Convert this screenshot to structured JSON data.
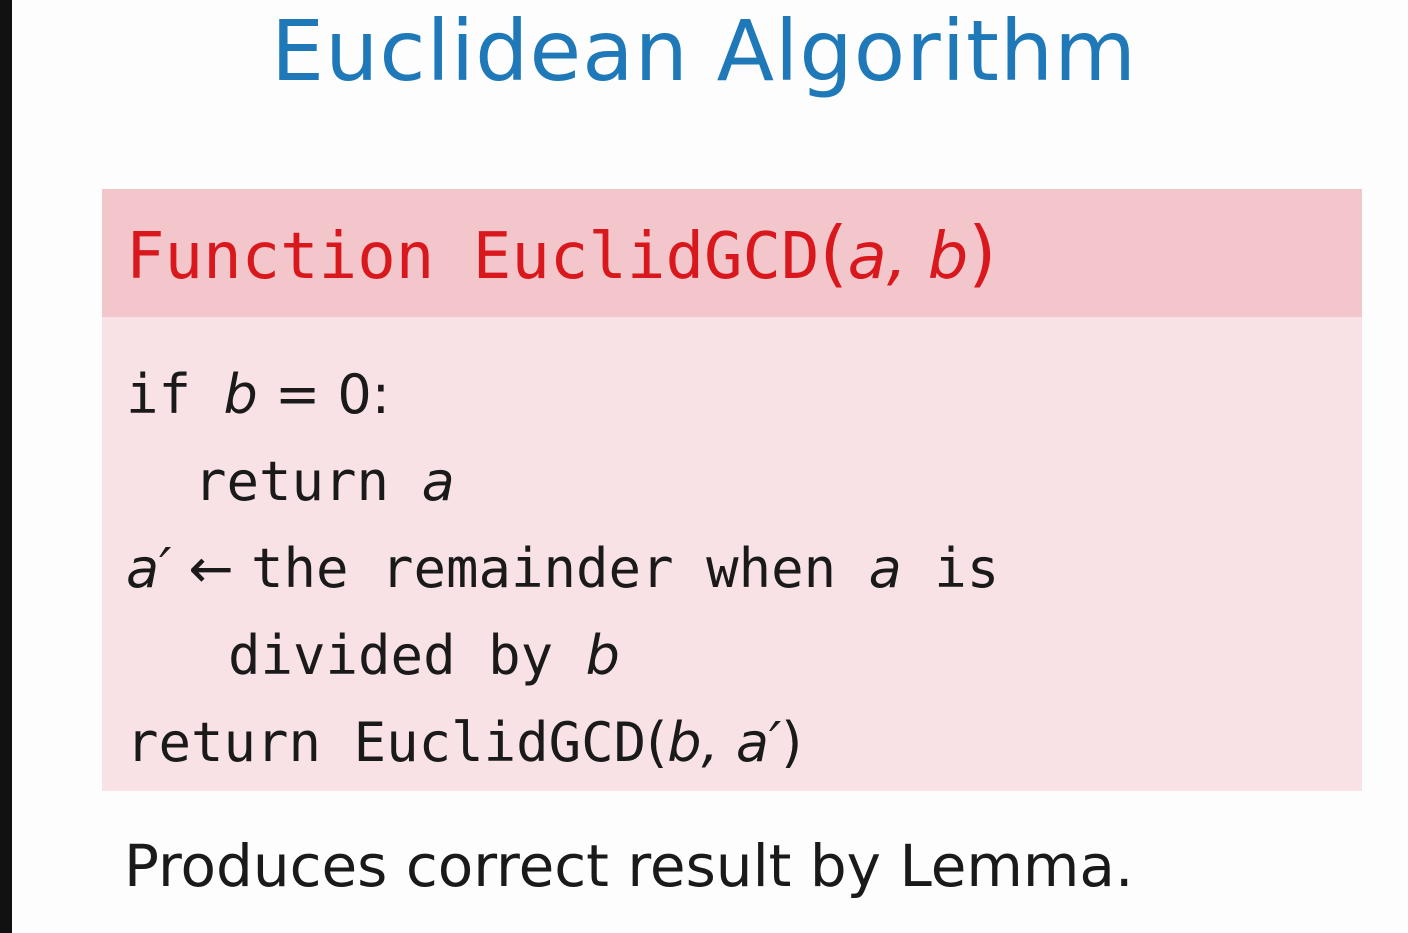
{
  "slide": {
    "title": "Euclidean Algorithm",
    "footer": "Produces correct result by Lemma."
  },
  "block": {
    "header": {
      "keyword": "Function ",
      "name": "EuclidGCD",
      "open": "(",
      "arg1": "a",
      "comma": ", ",
      "arg2": "b",
      "close": ")"
    },
    "lines": {
      "l1": {
        "kw": "if ",
        "var": "b",
        "rest": " = 0:"
      },
      "l2": {
        "kw": "return ",
        "var": "a"
      },
      "l3": {
        "var": "a′",
        "arrow": " ← ",
        "text": "the remainder when ",
        "var2": "a",
        "text2": " is"
      },
      "l4": {
        "text": "divided by ",
        "var": "b"
      },
      "l5": {
        "kw": "return ",
        "name": "EuclidGCD",
        "open": "(",
        "arg1": "b",
        "comma": ", ",
        "arg2": "a′",
        "close": ")"
      }
    }
  },
  "colors": {
    "title": "#1f78b8",
    "header_bg": "#f3c6cc",
    "header_text": "#d8181c",
    "body_bg": "#f8e2e5",
    "text": "#1a1a1a"
  }
}
